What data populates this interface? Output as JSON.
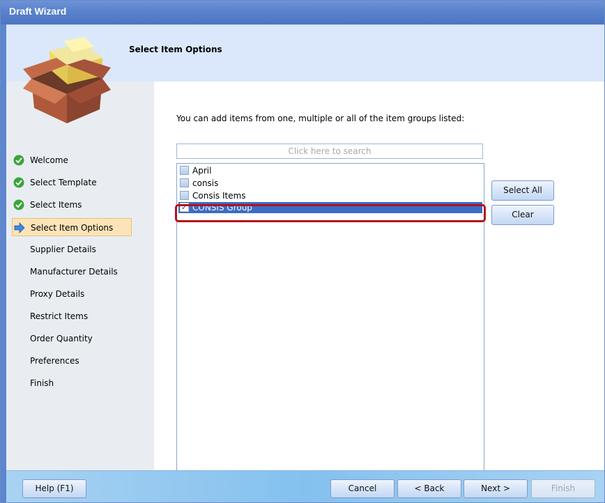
{
  "window": {
    "title": "Draft Wizard"
  },
  "header": {
    "title": "Select Item Options",
    "icon": "package-box-icon"
  },
  "sidebar": {
    "steps": [
      {
        "label": "Welcome",
        "status": "done"
      },
      {
        "label": "Select Template",
        "status": "done"
      },
      {
        "label": "Select Items",
        "status": "done"
      },
      {
        "label": "Select Item Options",
        "status": "current"
      },
      {
        "label": "Supplier Details",
        "status": "pending"
      },
      {
        "label": "Manufacturer Details",
        "status": "pending"
      },
      {
        "label": "Proxy Details",
        "status": "pending"
      },
      {
        "label": "Restrict Items",
        "status": "pending"
      },
      {
        "label": "Order Quantity",
        "status": "pending"
      },
      {
        "label": "Preferences",
        "status": "pending"
      },
      {
        "label": "Finish",
        "status": "pending"
      }
    ]
  },
  "main": {
    "instruction": "You can add items from one, multiple or all of the item groups listed:",
    "search": {
      "placeholder": "Click here to search",
      "value": ""
    },
    "item_groups": [
      {
        "label": "April",
        "checked": false
      },
      {
        "label": "consis",
        "checked": false
      },
      {
        "label": "Consis Items",
        "checked": false
      },
      {
        "label": "CONSIS Group",
        "checked": true,
        "selected": true
      }
    ],
    "select_all_label": "Select All",
    "clear_label": "Clear"
  },
  "footer": {
    "help_label": "Help (F1)",
    "cancel_label": "Cancel",
    "back_label": "< Back",
    "next_label": "Next >",
    "finish_label": "Finish"
  },
  "colors": {
    "title_bar": "#5a82cc",
    "header_bg": "#dbe8fb",
    "selection": "#3b6cc7",
    "highlight_border": "#b3121a",
    "done_check": "#3aa53a",
    "current_step_bg": "#fce4b8"
  }
}
